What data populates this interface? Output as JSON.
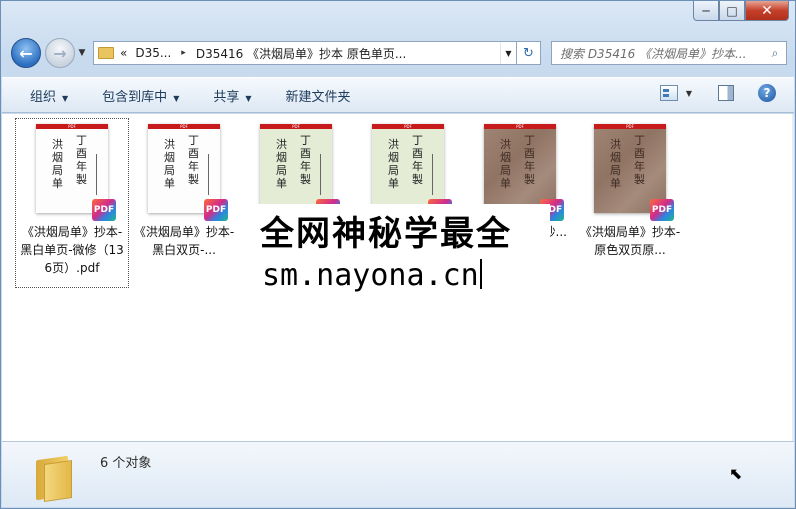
{
  "window": {
    "minimize": "─",
    "maximize": "□",
    "close": "✕"
  },
  "nav": {
    "back_icon": "arrow-left",
    "forward_icon": "arrow-right",
    "history_caret": "▼",
    "breadcrumb_overflow": "«",
    "breadcrumb": [
      "D35...",
      "D35416 《洪烟局单》抄本 原色单页..."
    ],
    "breadcrumb_sep": "▸",
    "address_drop": "▼",
    "refresh_icon": "↻",
    "search_placeholder": "搜索 D35416 《洪烟局单》抄本...",
    "search_icon": "⌕"
  },
  "toolbar": {
    "organize": "组织",
    "include_library": "包含到库中",
    "share": "共享",
    "new_folder": "新建文件夹",
    "caret": "▼",
    "help": "?"
  },
  "files": [
    {
      "name": "《洪烟局单》抄本-黑白单页-微修（136页）.pdf",
      "thumb": "white",
      "selected": true
    },
    {
      "name": "《洪烟局单》抄本-黑白双页-...",
      "thumb": "white",
      "selected": false
    },
    {
      "name": "",
      "thumb": "green",
      "selected": false
    },
    {
      "name": "",
      "thumb": "green",
      "selected": false
    },
    {
      "name": "抄...",
      "thumb": "brown",
      "selected": false
    },
    {
      "name": "《洪烟局单》抄本-原色双页原...",
      "thumb": "brown",
      "selected": false
    }
  ],
  "thumb_text": {
    "col1": "洪烟局单",
    "col2": "丁酉年製",
    "bar": "PDF"
  },
  "pdf_badge": "PDF",
  "watermark": {
    "line1": "全网神秘学最全",
    "line2": "sm.nayona.cn"
  },
  "details": {
    "count": "6 个对象"
  },
  "colors": {
    "accent": "#2c6fc0",
    "pdf_red": "#c71a1a",
    "close_red": "#c4402a"
  }
}
